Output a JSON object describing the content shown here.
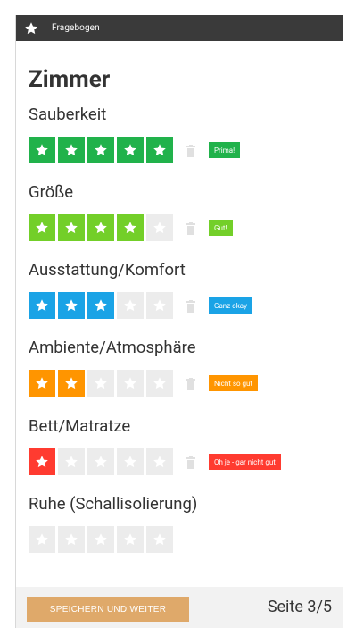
{
  "header": {
    "title": "Fragebogen",
    "icon": "star-icon"
  },
  "section": {
    "title": "Zimmer"
  },
  "questions": [
    {
      "label": "Sauberkeit",
      "rating": 5,
      "max": 5,
      "color": "#21b24b",
      "badge": "Prima!"
    },
    {
      "label": "Größe",
      "rating": 4,
      "max": 5,
      "color": "#73cf29",
      "badge": "Gut!"
    },
    {
      "label": "Ausstattung/Komfort",
      "rating": 3,
      "max": 5,
      "color": "#1aa3e6",
      "badge": "Ganz okay"
    },
    {
      "label": "Ambiente/Atmosphäre",
      "rating": 2,
      "max": 5,
      "color": "#ff9500",
      "badge": "Nicht so gut"
    },
    {
      "label": "Bett/Matratze",
      "rating": 1,
      "max": 5,
      "color": "#ff3b30",
      "badge": "Oh je - gar nicht gut"
    },
    {
      "label": "Ruhe (Schallisolierung)",
      "rating": 0,
      "max": 5,
      "color": "#ececec",
      "badge": ""
    }
  ],
  "footer": {
    "save_label": "SPEICHERN UND WEITER",
    "page": "Seite 3/5"
  },
  "colors": {
    "empty_star_bg": "#ececec",
    "topbar": "#3a3a3a",
    "save_button": "#dfa96a"
  }
}
